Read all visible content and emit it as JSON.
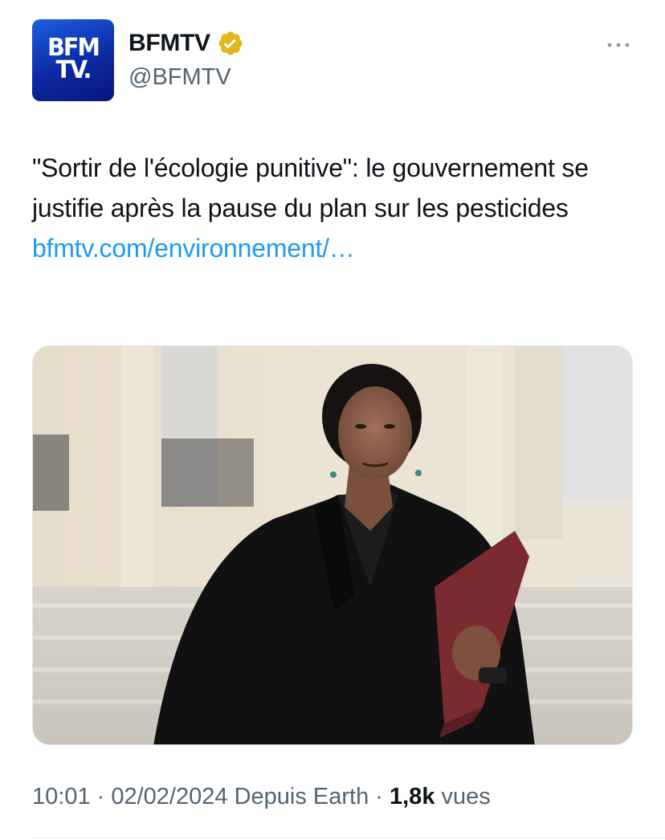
{
  "author": {
    "display_name": "BFMTV",
    "handle": "@BFMTV",
    "avatar_logo_line1": "BFM",
    "avatar_logo_line2": "TV.",
    "verified_badge": "verified-gold-badge-icon"
  },
  "tweet": {
    "text": "\"Sortir de l'écologie punitive\": le gouvernement se justifie après la pause du plan sur les pesticides",
    "link_text": "bfmtv.com/environnement/…"
  },
  "media": {
    "description": "photo"
  },
  "meta": {
    "time": "10:01",
    "separator1": " · ",
    "date": "02/02/2024",
    "source": " Depuis Earth",
    "separator2": " · ",
    "views_count": "1,8k",
    "views_label": " vues"
  },
  "colors": {
    "link": "#1d9bf0",
    "secondary_text": "#536471",
    "badge_gold": "#e2b719",
    "avatar_blue": "#0b2aa3"
  },
  "icons": {
    "more": "more-horizontal-icon"
  }
}
